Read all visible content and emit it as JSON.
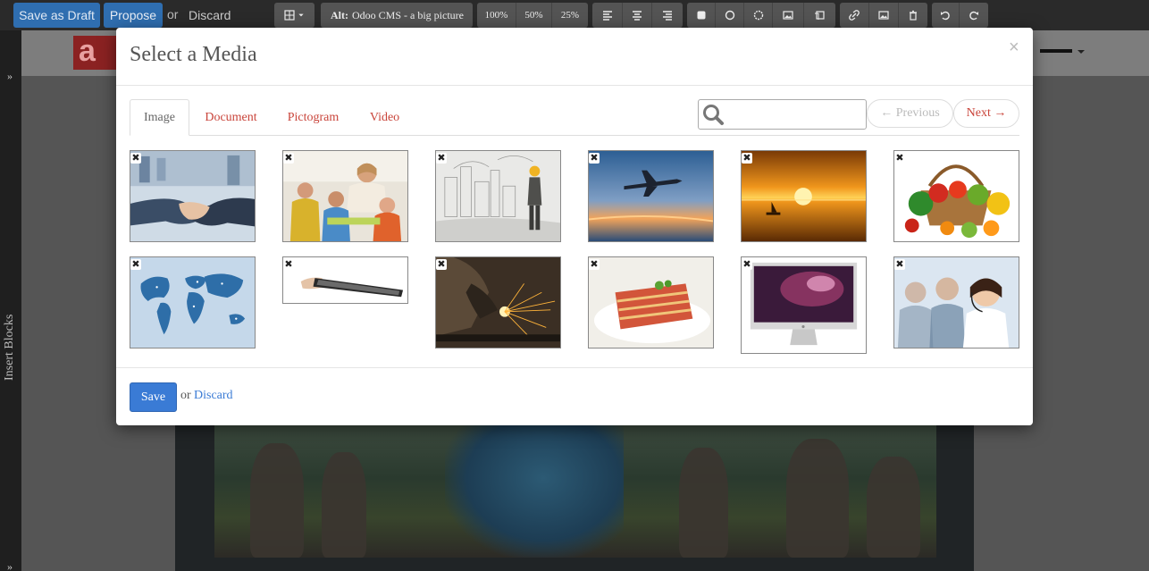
{
  "toolbar": {
    "save_draft": "Save as Draft",
    "propose": "Propose",
    "or": "or",
    "discard": "Discard",
    "alt_label": "Alt:",
    "alt_value": "Odoo CMS - a big picture",
    "size_100": "100%",
    "size_50": "50%",
    "size_25": "25%"
  },
  "sidebar": {
    "label": "Insert Blocks"
  },
  "modal": {
    "title": "Select a Media",
    "close": "×",
    "tabs": [
      {
        "label": "Image",
        "active": true
      },
      {
        "label": "Document",
        "active": false
      },
      {
        "label": "Pictogram",
        "active": false
      },
      {
        "label": "Video",
        "active": false
      }
    ],
    "search": {
      "value": "",
      "placeholder": ""
    },
    "pager": {
      "previous": "← Previous",
      "next": "Next →"
    },
    "images": [
      {
        "name": "handshake"
      },
      {
        "name": "classroom"
      },
      {
        "name": "city-sketch-worker"
      },
      {
        "name": "airplane-sunset"
      },
      {
        "name": "sea-sunset-sailboat"
      },
      {
        "name": "vegetable-basket"
      },
      {
        "name": "world-map"
      },
      {
        "name": "tablet-hand"
      },
      {
        "name": "welder-sparks"
      },
      {
        "name": "lasagna"
      },
      {
        "name": "imac"
      },
      {
        "name": "call-center"
      }
    ],
    "footer": {
      "save": "Save",
      "or": "or",
      "discard": "Discard"
    }
  },
  "colors": {
    "accent_blue": "#3a7bd5",
    "link_red": "#c9443a",
    "toolbar_bg": "#2a2a2a"
  }
}
